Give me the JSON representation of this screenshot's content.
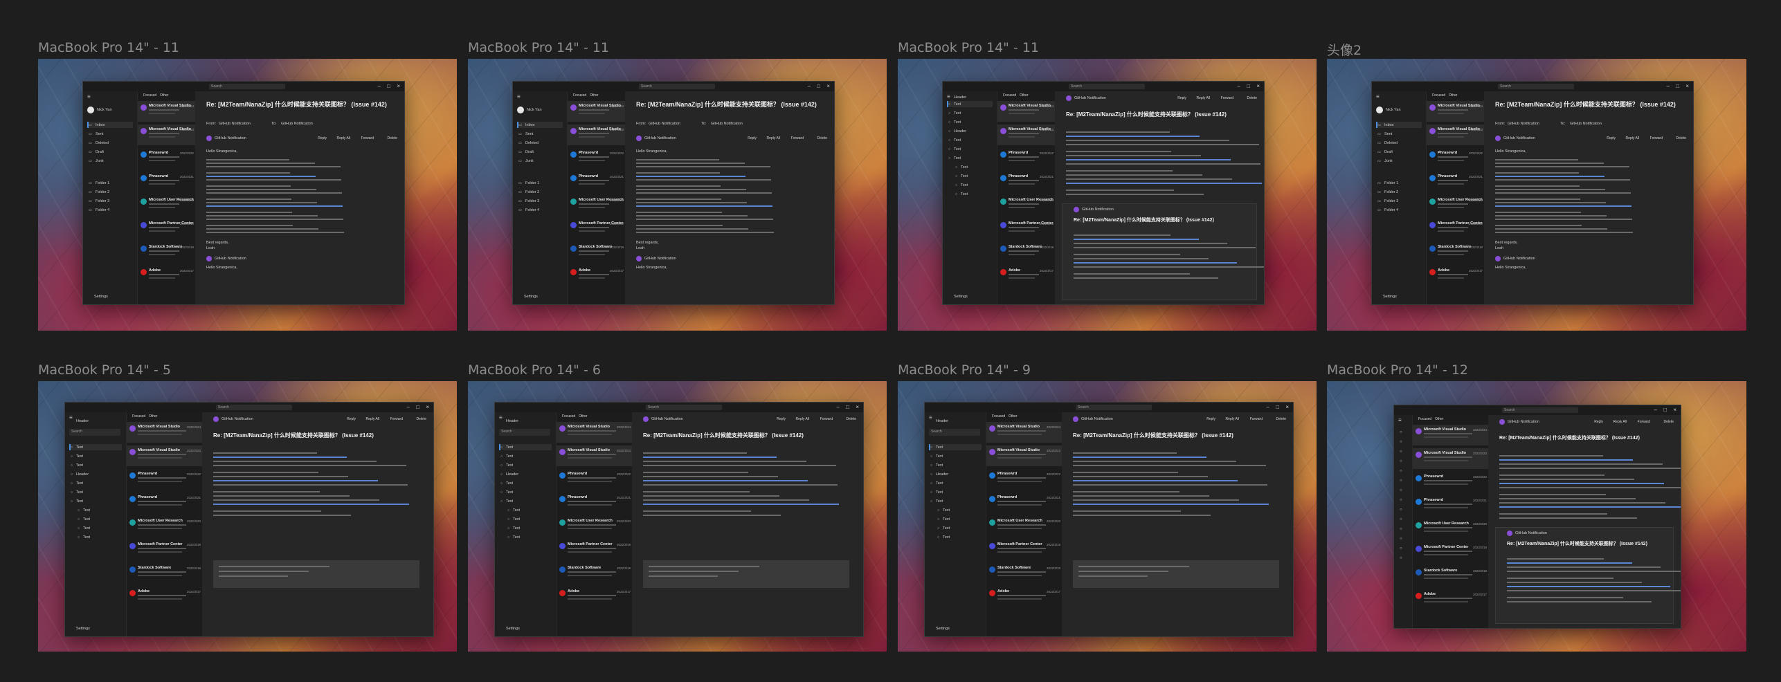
{
  "frames": [
    {
      "title": "MacBook Pro 14\" - 11"
    },
    {
      "title": "MacBook Pro 14\" - 11"
    },
    {
      "title": "MacBook Pro 14\" - 11"
    },
    {
      "title": "头像2"
    },
    {
      "title": "MacBook Pro 14\" - 5"
    },
    {
      "title": "MacBook Pro 14\" - 6"
    },
    {
      "title": "MacBook Pro 14\" - 9"
    },
    {
      "title": "MacBook Pro 14\" - 12"
    }
  ],
  "app": {
    "search_placeholder": "Search",
    "account_name": "Nick Yan",
    "tabs": [
      "Focused",
      "Other"
    ],
    "folders_main": [
      "Inbox",
      "Sent",
      "Deleted",
      "Draft",
      "Junk"
    ],
    "folders_extra": [
      "Folder 1",
      "Folder 2",
      "Folder 3",
      "Folder 4"
    ],
    "header_label": "Header",
    "text_label": "Text",
    "settings_label": "Settings",
    "senders": [
      "Microsoft Visual Studio",
      "Microsoft Visual Studio",
      "Phrasewrd",
      "Phrasewrd",
      "Microsoft User Research",
      "Microsoft Partner Center",
      "Stardock Software",
      "Adobe"
    ],
    "dates": [
      "2022/3/24",
      "2022/3/23",
      "2022/3/22",
      "2022/3/21",
      "2022/3/20",
      "2022/3/19",
      "2022/3/18",
      "2022/3/17"
    ],
    "subject": "Re: [M2Team/NanaZip] 什么时候能支持关联图标？ (Issue #142)",
    "from_label": "From:",
    "from_value": "GitHub Notification",
    "to_label": "To:",
    "to_value": "GitHub Notification",
    "notification_sender": "GitHub Notification",
    "greeting": "Hello Strangenica,",
    "regards": "Best regards,",
    "signoff": "Leah",
    "toolbar": [
      "Reply",
      "Reply All",
      "Forward",
      "Delete"
    ]
  },
  "colors": {
    "page_bg": "#1e1e1e",
    "app_bg": "#202020",
    "accent": "#4a90e2",
    "github_purple": "#8a4fd8",
    "phrase_blue": "#1e78d6"
  }
}
